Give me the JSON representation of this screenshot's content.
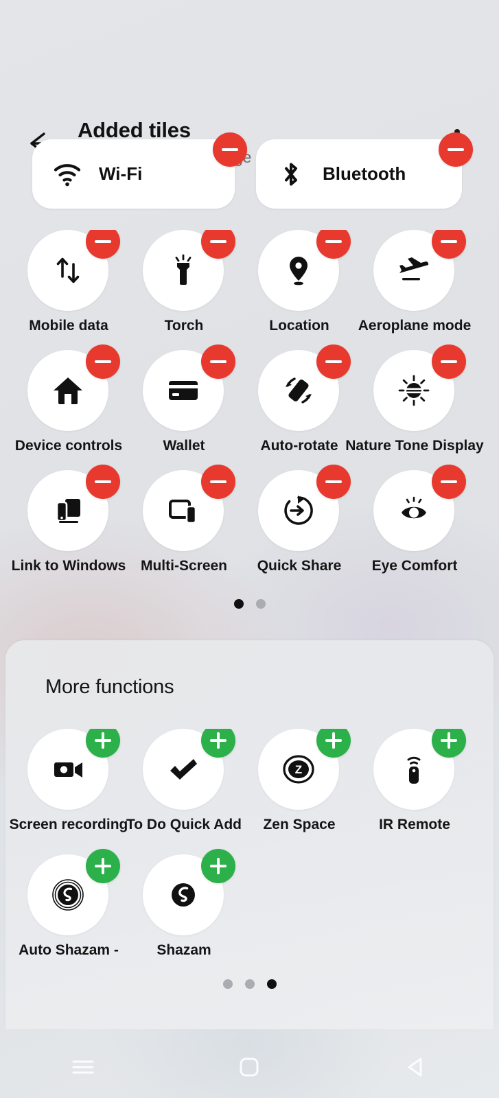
{
  "header": {
    "back_icon": "back-arrow-icon",
    "title": "Added tiles",
    "subtitle": "Hold and drag to arrange",
    "menu_icon": "more-options-icon"
  },
  "added_tiles": {
    "pills": [
      {
        "label": "Wi-Fi",
        "icon": "wifi-icon",
        "badge": "minus"
      },
      {
        "label": "Bluetooth",
        "icon": "bluetooth-icon",
        "badge": "minus"
      }
    ],
    "tiles": [
      {
        "label": "Mobile data",
        "icon": "mobile-data-icon",
        "badge": "minus"
      },
      {
        "label": "Torch",
        "icon": "torch-icon",
        "badge": "minus"
      },
      {
        "label": "Location",
        "icon": "location-pin-icon",
        "badge": "minus"
      },
      {
        "label": "Aeroplane mode",
        "icon": "aeroplane-icon",
        "badge": "minus"
      },
      {
        "label": "Device controls",
        "icon": "home-icon",
        "badge": "minus"
      },
      {
        "label": "Wallet",
        "icon": "wallet-card-icon",
        "badge": "minus"
      },
      {
        "label": "Auto-rotate",
        "icon": "auto-rotate-icon",
        "badge": "minus"
      },
      {
        "label": "Nature Tone Display",
        "icon": "nature-tone-icon",
        "badge": "minus"
      },
      {
        "label": "Link to Windows",
        "icon": "link-to-windows-icon",
        "badge": "minus"
      },
      {
        "label": "Multi-Screen",
        "icon": "multi-screen-icon",
        "badge": "minus"
      },
      {
        "label": "Quick Share",
        "icon": "quick-share-icon",
        "badge": "minus"
      },
      {
        "label": "Eye Comfort",
        "icon": "eye-comfort-icon",
        "badge": "minus"
      }
    ],
    "page_dots": {
      "count": 2,
      "active_index": 0
    }
  },
  "more_functions": {
    "title": "More functions",
    "tiles": [
      {
        "label": "Screen recording",
        "icon": "screen-record-icon",
        "badge": "plus"
      },
      {
        "label": "To Do Quick Add",
        "icon": "checkmark-icon",
        "badge": "plus"
      },
      {
        "label": "Zen Space",
        "icon": "zen-space-icon",
        "badge": "plus"
      },
      {
        "label": "IR Remote",
        "icon": "ir-remote-icon",
        "badge": "plus"
      },
      {
        "label": "Auto Shazam -",
        "icon": "auto-shazam-icon",
        "badge": "plus"
      },
      {
        "label": "Shazam",
        "icon": "shazam-icon",
        "badge": "plus"
      }
    ],
    "page_dots": {
      "count": 3,
      "active_index": 2
    }
  },
  "navbar": {
    "buttons": [
      {
        "name": "recents-button",
        "icon": "recents-icon"
      },
      {
        "name": "home-button",
        "icon": "home-square-icon"
      },
      {
        "name": "back-button",
        "icon": "back-triangle-icon"
      }
    ]
  },
  "colors": {
    "remove_badge": "#e8392f",
    "add_badge": "#2bb04a",
    "tile_bg": "#ffffff",
    "text": "#151515",
    "subtitle": "#6d6d70",
    "background": "#e2e4e7"
  }
}
